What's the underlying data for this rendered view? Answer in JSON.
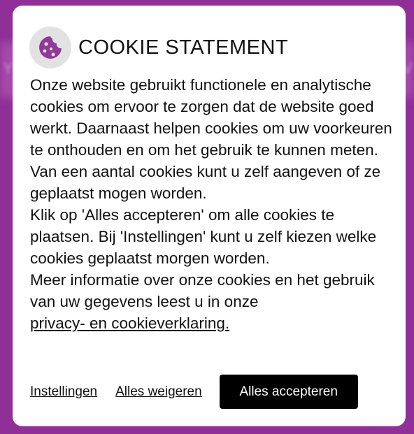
{
  "colors": {
    "accent": "#8e3a96",
    "backdrop": "#8f2f97",
    "button": "#000000",
    "icon_bg": "#e2e2e2"
  },
  "icons": {
    "header": "cookie-icon"
  },
  "header": {
    "title": "COOKIE STATEMENT"
  },
  "body": {
    "paragraph1": "Onze website gebruikt functionele en analytische cookies om ervoor te zorgen dat de website goed werkt. Daarnaast helpen cookies om uw voorkeuren te onthouden en om het gebruik te kunnen meten. Van een aantal cookies kunt u zelf aangeven of ze geplaatst mogen worden.",
    "paragraph2": "Klik op 'Alles accepteren' om alle cookies te plaatsen. Bij 'Instellingen' kunt u zelf kiezen welke cookies geplaatst morgen worden.",
    "paragraph3": "Meer informatie over onze cookies en het gebruik van uw gegevens leest u in onze",
    "privacy_link": "privacy- en cookieverklaring."
  },
  "actions": {
    "settings_label": "Instellingen",
    "reject_label": "Alles weigeren",
    "accept_label": "Alles accepteren"
  }
}
